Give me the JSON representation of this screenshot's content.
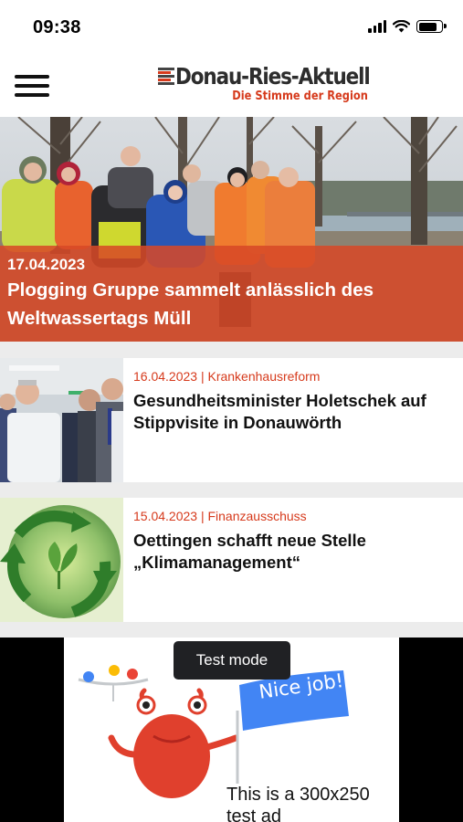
{
  "status_bar": {
    "time": "09:38"
  },
  "header": {
    "logo_title": "Donau-Ries-Aktuell",
    "logo_subtitle": "Die Stimme der Region",
    "menu_icon": "hamburger-menu-icon"
  },
  "featured": {
    "date": "17.04.2023",
    "title": "Plogging Gruppe sammelt anlässlich des Weltwassertags Müll"
  },
  "articles": [
    {
      "date": "16.04.2023",
      "category": "Krankenhausreform",
      "meta": "16.04.2023 | Krankenhausreform",
      "title": "Gesundheitsminister Holetschek auf Stippvisite in Donauwörth"
    },
    {
      "date": "15.04.2023",
      "category": "Finanzausschuss",
      "meta": "15.04.2023 | Finanzausschuss",
      "title": "Oettingen schafft neue Stelle „Klimamanagement“"
    }
  ],
  "ad": {
    "badge": "Test mode",
    "flag_text": "Nice job!",
    "body_text": "This is a 300x250 test ad"
  },
  "colors": {
    "accent": "#d63a1c",
    "overlay": "#d74826",
    "divider": "#ececec",
    "ad_badge": "#202124"
  }
}
